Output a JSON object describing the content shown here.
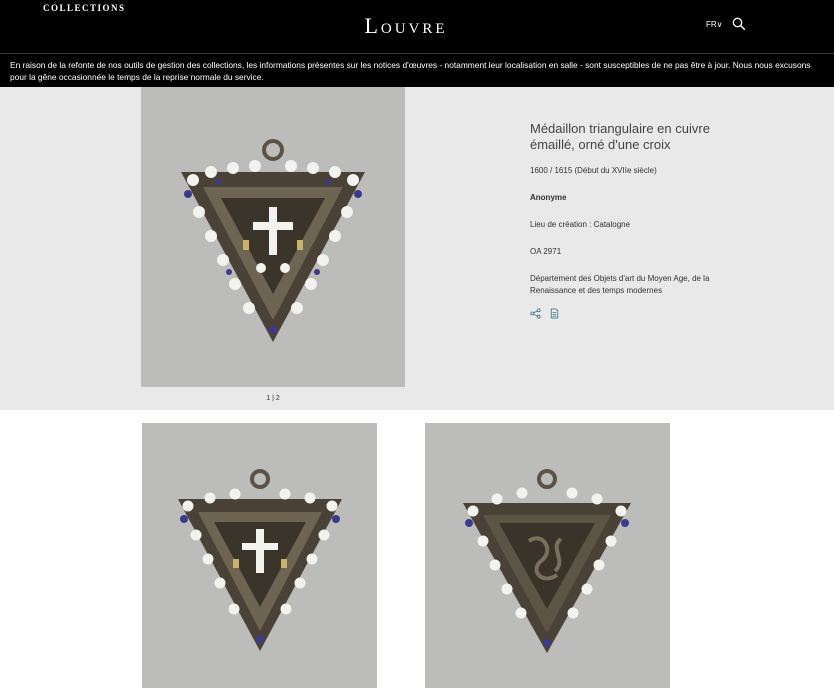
{
  "header": {
    "collections_label": "COLLECTIONS",
    "logo": "Louvre",
    "language": "FR",
    "icons": [
      "chevron-down-icon",
      "search-icon"
    ]
  },
  "notice": {
    "text": "En raison de la refonte de nos outils de gestion des collections, les informations présentes sur les notices d'œuvres - notamment leur localisation en salle - sont susceptibles de ne pas être à jour. Nous nous excusons pour la gêne occasionnée le temps de la reprise normale du service."
  },
  "artwork": {
    "title": "Médaillon triangulaire en cuivre émaillé, orné d'une croix",
    "date": "1600 / 1615 (Début du XVIIe siècle)",
    "artist": "Anonyme",
    "place": "Lieu de création : Catalogne",
    "inventory": "OA 2971",
    "department": "Département des Objets d'art du Moyen Age, de la Renaissance et des temps modernes",
    "pager": "1 | 2",
    "icons": [
      "share-icon",
      "document-icon"
    ]
  },
  "colors": {
    "header_bg": "#000000",
    "hero_bg": "#e9e9e9",
    "photo_bg": "#bcbcba",
    "accent": "#4a7f8c"
  }
}
